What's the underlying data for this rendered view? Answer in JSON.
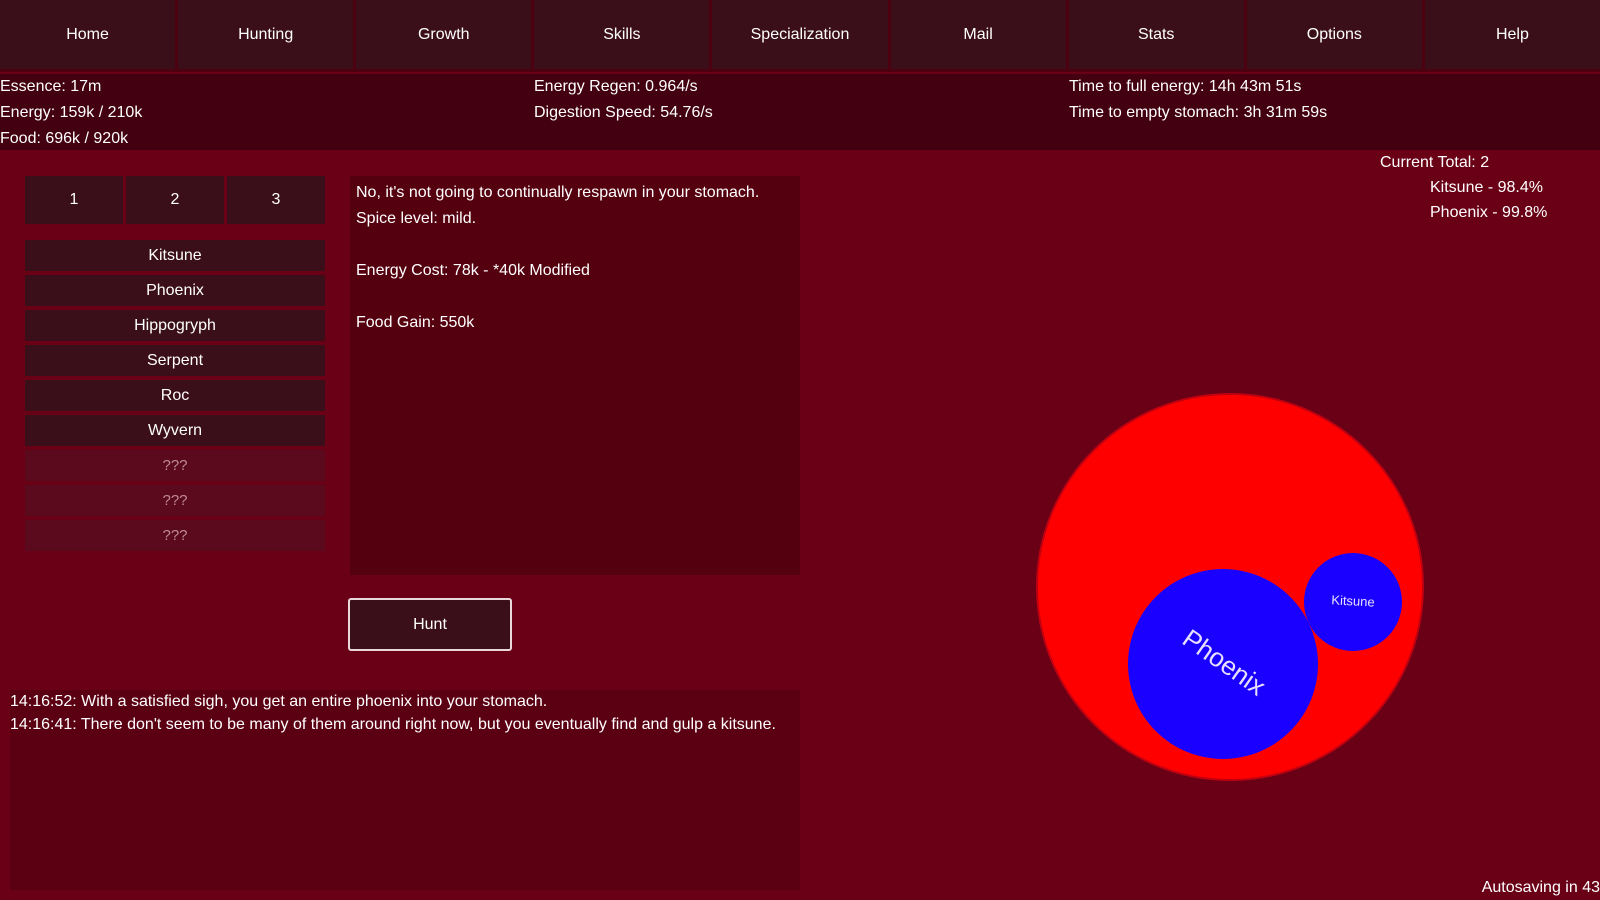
{
  "nav": {
    "items": [
      "Home",
      "Hunting",
      "Growth",
      "Skills",
      "Specialization",
      "Mail",
      "Stats",
      "Options",
      "Help"
    ]
  },
  "stats": {
    "essence": "Essence: 17m",
    "energy": "Energy: 159k / 210k",
    "food": "Food: 696k / 920k",
    "energy_regen": "Energy Regen: 0.964/s",
    "digestion_speed": "Digestion Speed: 54.76/s",
    "time_full_energy": "Time to full energy: 14h 43m 51s",
    "time_empty_stomach": "Time to empty stomach: 3h 31m 59s"
  },
  "tabs": [
    "1",
    "2",
    "3"
  ],
  "prey": [
    {
      "label": "Kitsune",
      "locked": false
    },
    {
      "label": "Phoenix",
      "locked": false
    },
    {
      "label": "Hippogryph",
      "locked": false
    },
    {
      "label": "Serpent",
      "locked": false
    },
    {
      "label": "Roc",
      "locked": false
    },
    {
      "label": "Wyvern",
      "locked": false
    },
    {
      "label": "???",
      "locked": true
    },
    {
      "label": "???",
      "locked": true
    },
    {
      "label": "???",
      "locked": true
    }
  ],
  "description": {
    "text": "No, it's not going to continually respawn in your stomach. Spice level: mild.",
    "energy_cost": "Energy Cost: 78k - *40k Modified",
    "food_gain": "Food Gain: 550k"
  },
  "hunt_button": "Hunt",
  "log": [
    "14:16:52: With a satisfied sigh, you get an entire phoenix into your stomach.",
    "14:16:41: There don't seem to be many of them around right now, but you eventually find and gulp a kitsune."
  ],
  "totals": {
    "title": "Current Total: 2",
    "rows": [
      "Kitsune - 98.4%",
      "Phoenix - 99.8%"
    ]
  },
  "stomach": {
    "stomach_color": "#ff0000",
    "prey_color": "#1a00ff",
    "contents": [
      {
        "name": "Phoenix"
      },
      {
        "name": "Kitsune"
      }
    ]
  },
  "autosave": "Autosaving in 43"
}
